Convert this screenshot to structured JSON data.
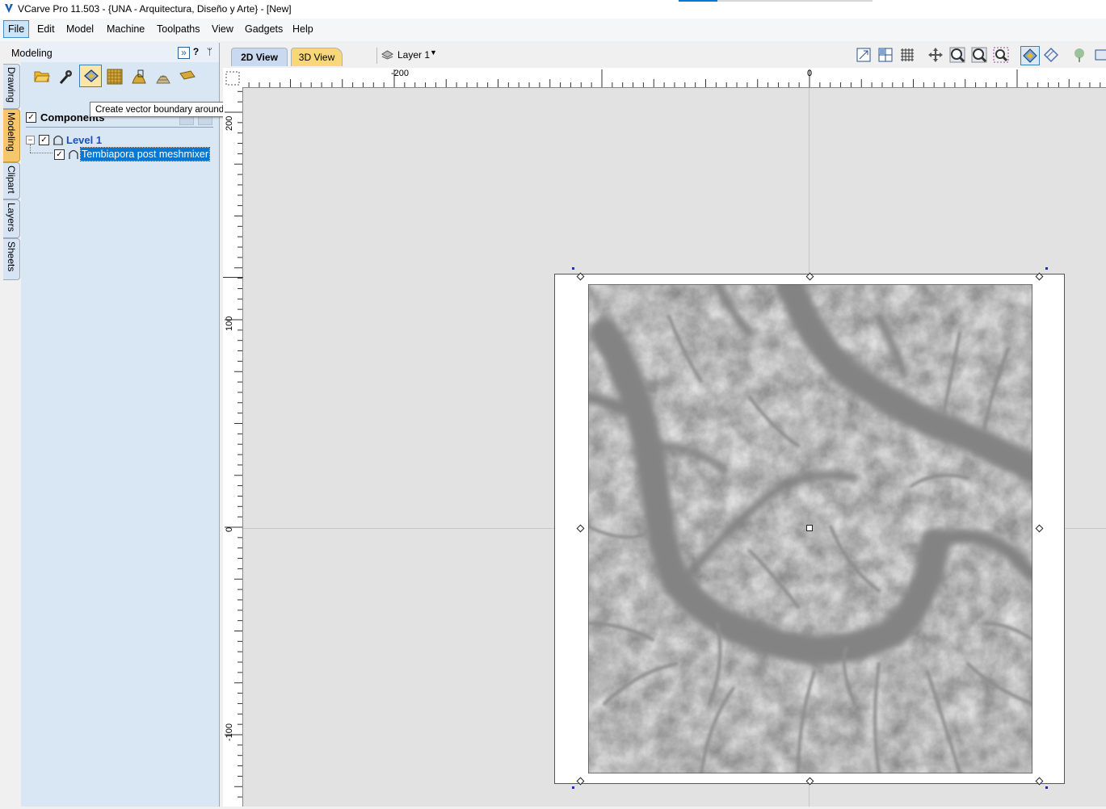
{
  "window": {
    "title": "VCarve Pro 11.503 - {UNA - Arquitectura, Diseño y Arte} - [New]"
  },
  "menu": [
    "File",
    "Edit",
    "Model",
    "Machine",
    "Toolpaths",
    "View",
    "Gadgets",
    "Help"
  ],
  "side_tabs": [
    "Drawing",
    "Modeling",
    "Clipart",
    "Layers",
    "Sheets"
  ],
  "panel": {
    "title": "Modeling",
    "help_glyph": "?",
    "tools": [
      "open-component-icon",
      "sculpt-icon",
      "vector-boundary-icon",
      "texture-icon",
      "create-shape-icon",
      "slice-icon",
      "bitmap-icon"
    ],
    "tooltip": "Create vector boundary around selected components",
    "components_label": "Components",
    "tree": {
      "level_label": "Level 1",
      "component_label": "Tembiapora post meshmixer"
    }
  },
  "view_tabs": [
    "2D View",
    "3D View"
  ],
  "layer_selector": "Layer 1",
  "ruler": {
    "top_labels": [
      "-200",
      "0"
    ],
    "left_labels": [
      "200",
      "100",
      "0",
      "-100"
    ]
  },
  "colors": {
    "selection": "#0078d7",
    "panel_bg": "#d9e6f4",
    "active_tab": "#f7c66a",
    "canvas_bg": "#e2e2e2"
  }
}
